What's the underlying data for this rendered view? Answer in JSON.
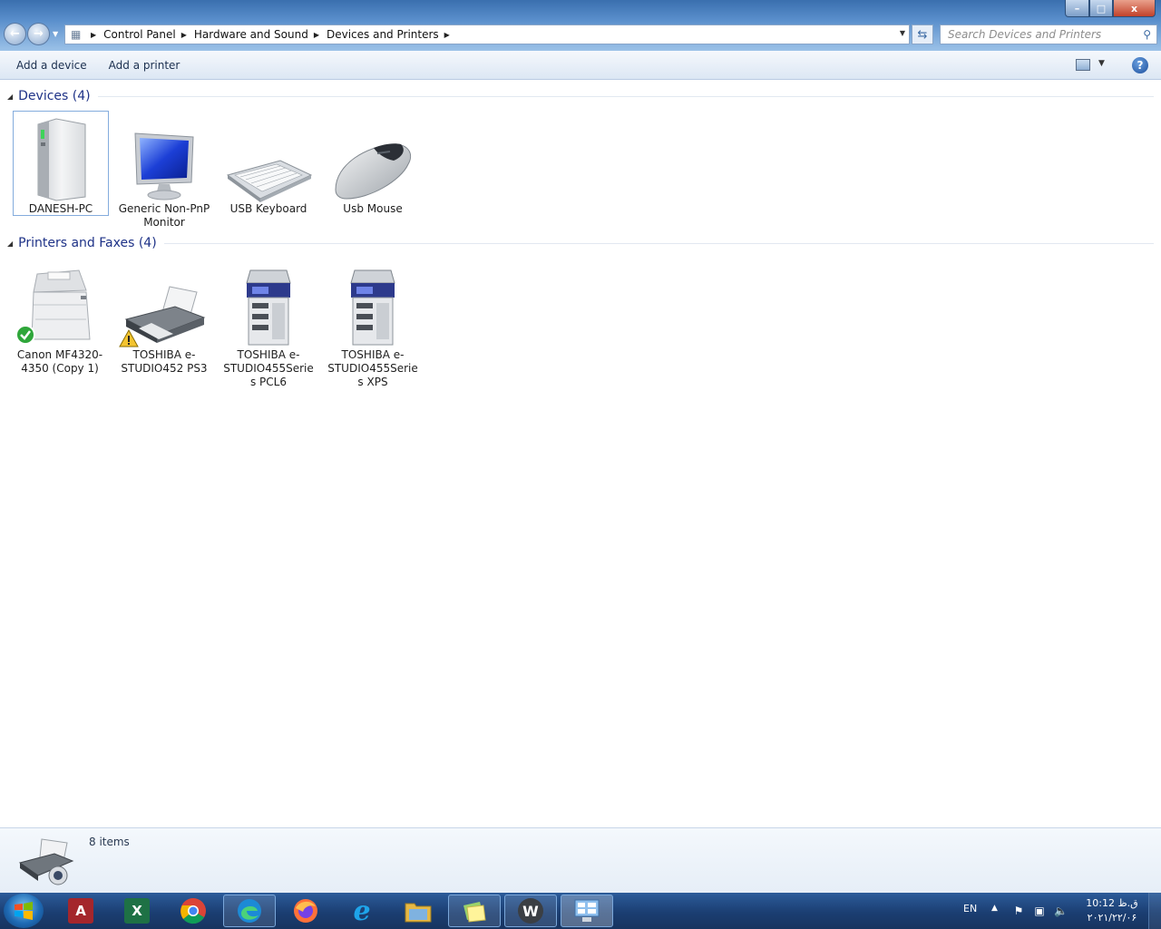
{
  "window": {
    "address": {
      "crumbs": [
        "Control Panel",
        "Hardware and Sound",
        "Devices and Printers"
      ]
    },
    "search": {
      "placeholder": "Search Devices and Printers"
    },
    "controls": {
      "minimize": "–",
      "maximize": "□",
      "close": "x"
    }
  },
  "toolbar": {
    "add_device": "Add a device",
    "add_printer": "Add a printer",
    "help": "?"
  },
  "groups": {
    "devices": {
      "title": "Devices (4)",
      "items": [
        {
          "label": "DANESH-PC",
          "icon": "computer-tower-icon",
          "selected": true
        },
        {
          "label": "Generic Non-PnP Monitor",
          "icon": "monitor-icon"
        },
        {
          "label": "USB Keyboard",
          "icon": "keyboard-icon"
        },
        {
          "label": "Usb Mouse",
          "icon": "mouse-icon"
        }
      ]
    },
    "printers": {
      "title": "Printers and Faxes (4)",
      "items": [
        {
          "label": "Canon MF4320-4350 (Copy 1)",
          "icon": "multifunction-printer-icon",
          "badge": "default-check-badge"
        },
        {
          "label": "TOSHIBA e-STUDIO452 PS3",
          "icon": "inkjet-printer-icon",
          "badge": "warning-badge"
        },
        {
          "label": "TOSHIBA e-STUDIO455Series PCL6",
          "icon": "copier-icon"
        },
        {
          "label": "TOSHIBA e-STUDIO455Series XPS",
          "icon": "copier-icon"
        }
      ]
    }
  },
  "status": {
    "count": "8 items"
  },
  "taskbar": {
    "apps": [
      "access-icon",
      "excel-icon",
      "chrome-icon",
      "edge-icon",
      "firefox-icon",
      "internet-explorer-icon",
      "file-explorer-icon",
      "sticky-notes-icon",
      "wps-writer-icon",
      "devices-and-printers-icon"
    ],
    "tray": {
      "lang": "EN",
      "time": "10:12 ق.ظ",
      "date": "۲۰۲۱/۲۲/۰۶"
    }
  },
  "colors": {
    "group_title": "#1e3287",
    "selection_border": "#84acdd",
    "taskbar": "#1b3e72"
  }
}
